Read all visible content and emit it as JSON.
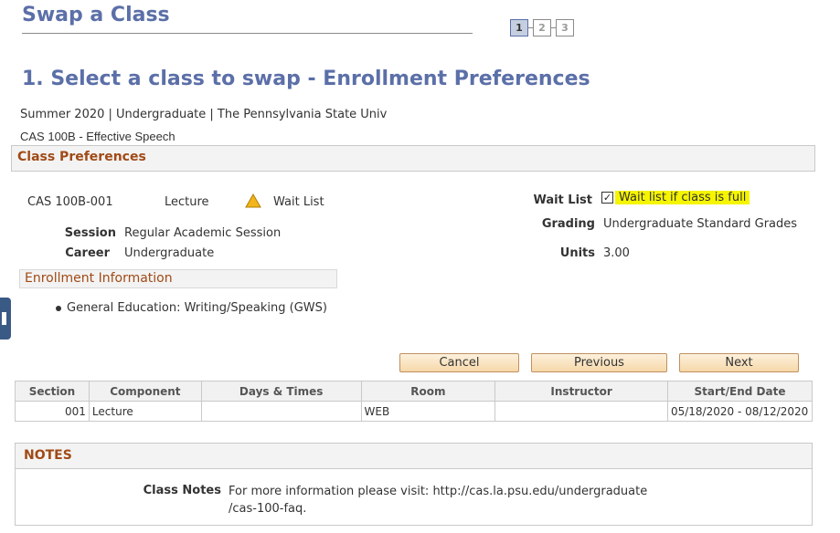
{
  "page": {
    "title": "Swap a Class",
    "steps": [
      "1",
      "2",
      "3"
    ],
    "heading": "1.  Select a class to swap - Enrollment Preferences",
    "term_line": "Summer 2020 | Undergraduate | The Pennsylvania State Univ",
    "course_line": "CAS  100B - Effective Speech"
  },
  "class_preferences": {
    "section_title": "Class Preferences",
    "class_id": "CAS  100B-001",
    "component": "Lecture",
    "status_icon": "warning-triangle-icon",
    "status_text": "Wait List",
    "session_label": "Session",
    "session_value": "Regular Academic Session",
    "career_label": "Career",
    "career_value": "Undergraduate",
    "waitlist_label": "Wait List",
    "waitlist_checked": true,
    "waitlist_checkbox_mark": "✓",
    "waitlist_option": "Wait list if class is full",
    "grading_label": "Grading",
    "grading_value": "Undergraduate Standard Grades",
    "units_label": "Units",
    "units_value": "3.00"
  },
  "enrollment_information": {
    "title": "Enrollment Information",
    "items": [
      "General Education: Writing/Speaking (GWS)"
    ]
  },
  "buttons": {
    "cancel": "Cancel",
    "previous": "Previous",
    "next": "Next"
  },
  "sections_table": {
    "headers": [
      "Section",
      "Component",
      "Days & Times",
      "Room",
      "Instructor",
      "Start/End Date"
    ],
    "rows": [
      [
        "001",
        "Lecture",
        "",
        "WEB",
        "",
        "05/18/2020 - 08/12/2020"
      ]
    ]
  },
  "notes": {
    "title": "NOTES",
    "class_notes_label": "Class Notes",
    "class_notes_line1": "For more information please visit:  http://cas.la.psu.edu/undergraduate",
    "class_notes_line2": "/cas-100-faq."
  },
  "colors": {
    "title_blue": "#5b6fa8",
    "section_orange": "#a04a16",
    "highlight_yellow": "#f6f500",
    "button_fill": "#f6d8a8"
  }
}
